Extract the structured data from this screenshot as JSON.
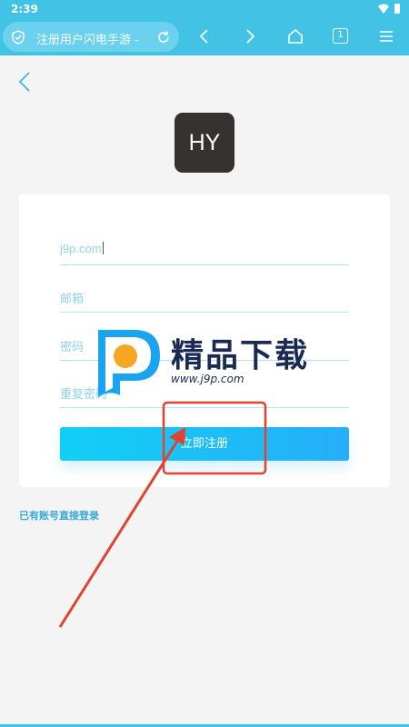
{
  "status_bar": {
    "time": "2:39"
  },
  "browser": {
    "url_title": "注册用户闪电手游 -",
    "tab_count": "1",
    "icons": [
      "shield-icon",
      "reload-icon",
      "back-icon",
      "forward-icon",
      "home-icon",
      "tabs-icon",
      "menu-icon"
    ]
  },
  "app": {
    "logo_text": "HY"
  },
  "form": {
    "username_value": "j9p.com",
    "email_placeholder": "邮箱",
    "password_placeholder": "密码",
    "confirm_placeholder": "重复密码",
    "submit_label": "立即注册"
  },
  "login_link": "已有账号直接登录",
  "watermark": {
    "text": "精品下载",
    "url": "www.j9p.com"
  },
  "colors": {
    "accent": "#42c3e6",
    "button_start": "#12cff5",
    "button_end": "#26aef8",
    "annotation": "#e0432f"
  }
}
